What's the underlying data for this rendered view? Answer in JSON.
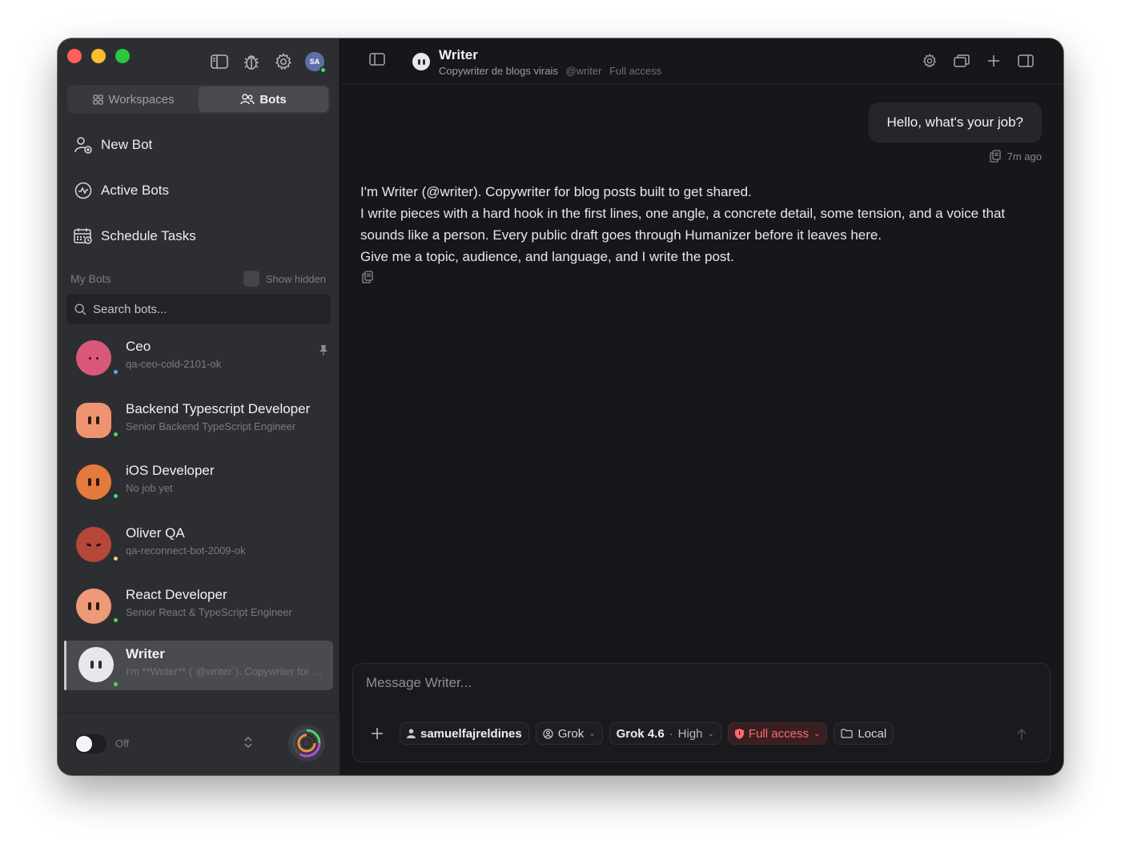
{
  "sidebar": {
    "avatar_initials": "SA",
    "tabs": [
      {
        "label": "Workspaces",
        "active": false
      },
      {
        "label": "Bots",
        "active": true
      }
    ],
    "nav": [
      {
        "label": "New Bot",
        "icon": "add-user-icon"
      },
      {
        "label": "Active Bots",
        "icon": "activity-icon"
      },
      {
        "label": "Schedule Tasks",
        "icon": "calendar-icon"
      }
    ],
    "my_bots_label": "My Bots",
    "show_hidden_label": "Show hidden",
    "search_placeholder": "Search bots...",
    "bots": [
      {
        "name": "Ceo",
        "sub": "qa-ceo-cold-2101-ok",
        "color": "#d9587a",
        "status": "#5aa7ff",
        "pinned": true
      },
      {
        "name": "Backend Typescript Developer",
        "sub": "Senior Backend TypeScript Engineer",
        "color": "#ee9471",
        "status": "#4cd964"
      },
      {
        "name": "iOS Developer",
        "sub": "No job yet",
        "color": "#e47a3e",
        "status": "#4cd964"
      },
      {
        "name": "Oliver QA",
        "sub": "qa-reconnect-bot-2009-ok",
        "color": "#b6473a",
        "status": "#f6d365"
      },
      {
        "name": "React Developer",
        "sub": "Senior React & TypeScript Engineer",
        "color": "#ee9a76",
        "status": "#4cd964"
      },
      {
        "name": "Writer",
        "sub": "I'm **Writer** (`@writer`). Copywriter for blog posts built to get shared.",
        "color": "#e7e8ec",
        "status": "#4cd964",
        "selected": true
      }
    ],
    "footer": {
      "toggle_label": "Off"
    }
  },
  "chat": {
    "title": "Writer",
    "subtitle": "Copywriter de blogs virais",
    "handle": "@writer",
    "access": "Full access",
    "user_message": "Hello, what's your job?",
    "user_time": "7m ago",
    "assistant_lines": [
      "I'm Writer (@writer). Copywriter for blog posts built to get shared.",
      "I write pieces with a hard hook in the first lines, one angle, a concrete detail, some tension, and a voice that sounds like a person. Every public draft goes through Humanizer before it leaves here.",
      "Give me a topic, audience, and language, and I write the post."
    ],
    "composer": {
      "placeholder": "Message Writer...",
      "user_chip": "samuelfajreldines",
      "provider_chip": "Grok",
      "model": "Grok 4.6",
      "effort": "High",
      "access_chip": "Full access",
      "location_chip": "Local"
    }
  },
  "colors": {
    "accent_danger": "#ff6a6a",
    "window_bg": "#15171b",
    "sidebar_bg": "#2d2e32"
  }
}
